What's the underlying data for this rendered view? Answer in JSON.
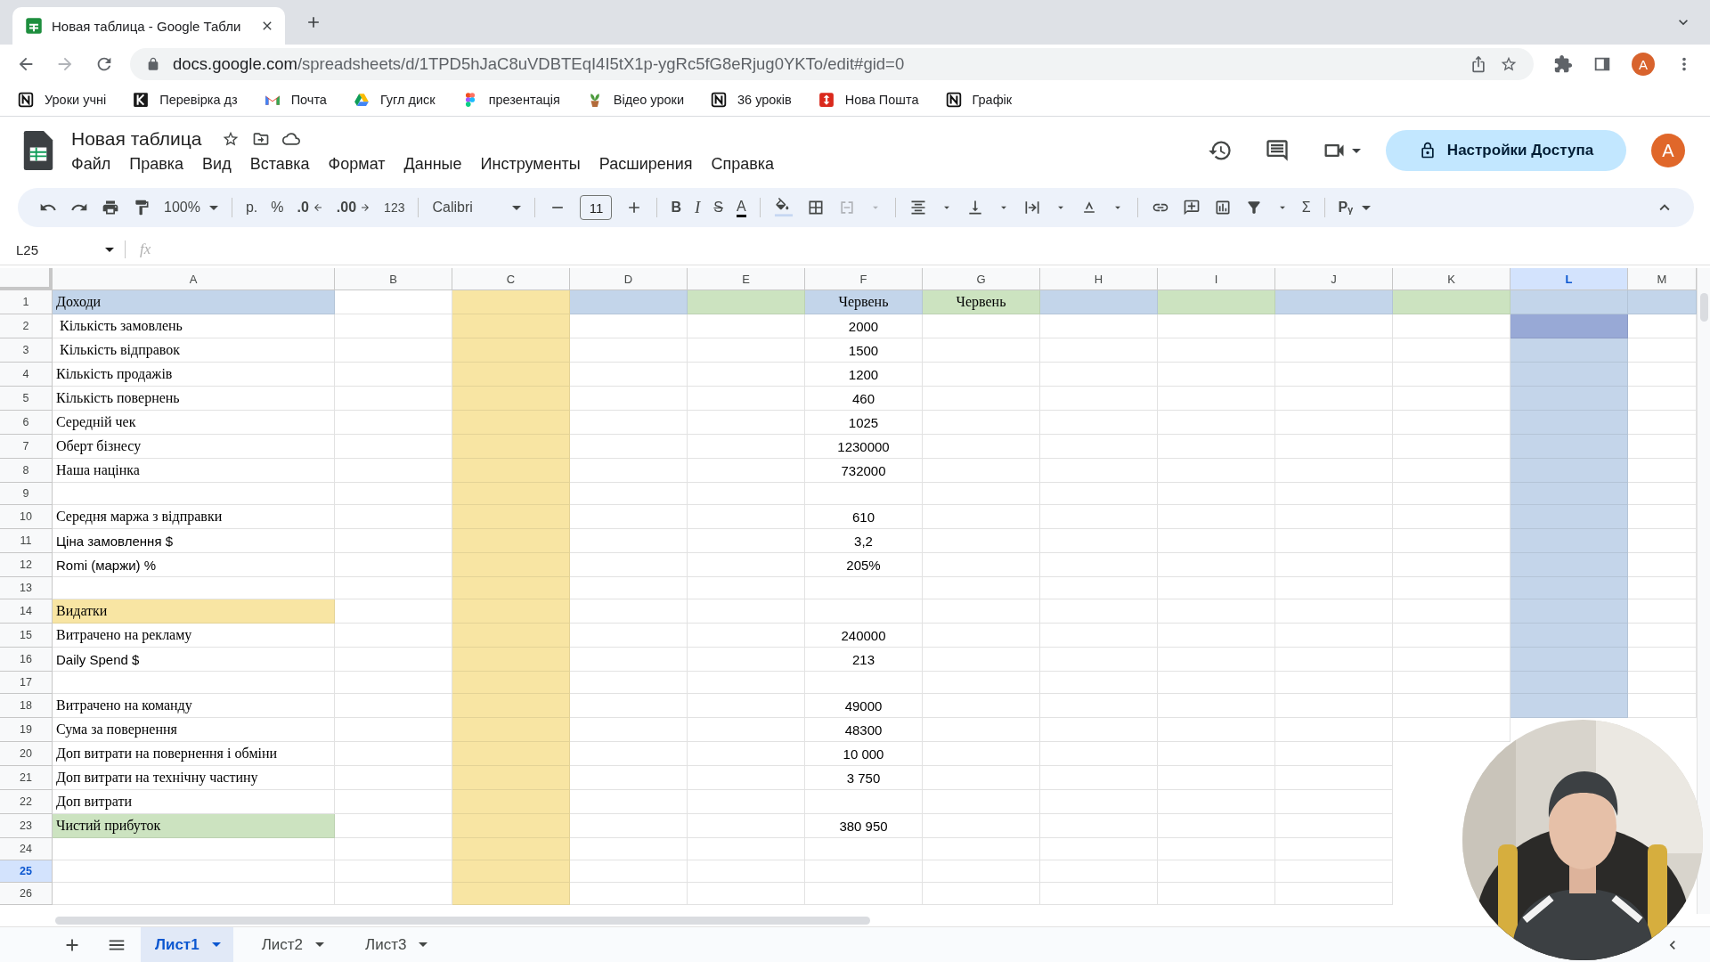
{
  "browser": {
    "tab_title": "Новая таблица - Google Табли",
    "url_host": "docs.google.com",
    "url_path": "/spreadsheets/d/1TPD5hJaC8uVDBTEqI4I5tX1p-ygRc5fG8eRjug0YKTo/edit#gid=0",
    "profile": "A",
    "bookmarks": [
      {
        "label": "Уроки учні",
        "kind": "notion"
      },
      {
        "label": "Перевірка дз",
        "kind": "k"
      },
      {
        "label": "Почта",
        "kind": "gmail"
      },
      {
        "label": "Гугл диск",
        "kind": "drive"
      },
      {
        "label": "презентація",
        "kind": "figma"
      },
      {
        "label": "Відео уроки",
        "kind": "plant"
      },
      {
        "label": "36 уроків",
        "kind": "notion"
      },
      {
        "label": "Нова Пошта",
        "kind": "nova"
      },
      {
        "label": "Графік",
        "kind": "notion"
      }
    ]
  },
  "document": {
    "title": "Новая таблица",
    "menu": [
      "Файл",
      "Правка",
      "Вид",
      "Вставка",
      "Формат",
      "Данные",
      "Инструменты",
      "Расширения",
      "Справка"
    ],
    "share_button": "Настройки Доступа",
    "avatar": "A"
  },
  "toolbar": {
    "zoom": "100%",
    "currency": "р.",
    "percent": "%",
    "decrease_decimals": ".0",
    "increase_decimals": ".00",
    "number_format": "123",
    "font": "Calibri",
    "font_size": "11",
    "bold": "B",
    "italic": "I",
    "strikethrough": "S",
    "text_color": "A",
    "functions": "Σ",
    "input_tools": "Pᵧ"
  },
  "formula_bar": {
    "cell_reference": "L25",
    "fx": "fx"
  },
  "sheet": {
    "columns": [
      {
        "label": "A",
        "selected": false
      },
      {
        "label": "B",
        "selected": false
      },
      {
        "label": "C",
        "selected": false,
        "color": "#f8e5a3"
      },
      {
        "label": "D",
        "selected": false
      },
      {
        "label": "E",
        "selected": false
      },
      {
        "label": "F",
        "selected": false
      },
      {
        "label": "G",
        "selected": false
      },
      {
        "label": "H",
        "selected": false
      },
      {
        "label": "I",
        "selected": false
      },
      {
        "label": "J",
        "selected": false
      },
      {
        "label": "K",
        "selected": false
      },
      {
        "label": "L",
        "selected": true
      },
      {
        "label": "M",
        "selected": false
      }
    ],
    "rows": [
      {
        "number": "1",
        "selected": false,
        "cells": [
          {
            "text": "Доходи",
            "color": "#c3d5ea"
          },
          {},
          {},
          {
            "color": "#c3d5ea"
          },
          {
            "color": "#cce3c0"
          },
          {
            "text": "Червень",
            "color": "#c3d5ea"
          },
          {
            "text": "Червень",
            "color": "#cce3c0"
          },
          {
            "color": "#c3d5ea"
          },
          {
            "color": "#cce3c0"
          },
          {
            "color": "#c3d5ea"
          },
          {
            "color": "#cce3c0"
          },
          {
            "color": "#c3d5ea"
          },
          {
            "color": "#c3d5ea"
          }
        ]
      },
      {
        "number": "2",
        "selected": false,
        "cells": [
          {
            "text": " Кількість замовлень"
          },
          {},
          {},
          {},
          {},
          {
            "text": "2000"
          },
          {},
          {},
          {},
          {},
          {},
          {
            "color": "#98a9d6"
          },
          {}
        ]
      },
      {
        "number": "3",
        "selected": false,
        "cells": [
          {
            "text": " Кількість відправок"
          },
          {},
          {},
          {},
          {},
          {
            "text": "1500"
          },
          {},
          {},
          {},
          {},
          {},
          {},
          {}
        ]
      },
      {
        "number": "4",
        "selected": false,
        "cells": [
          {
            "text": "Кількість продажів"
          },
          {},
          {},
          {},
          {},
          {
            "text": "1200"
          },
          {},
          {},
          {},
          {},
          {},
          {},
          {}
        ]
      },
      {
        "number": "5",
        "selected": false,
        "cells": [
          {
            "text": "Кількість повернень"
          },
          {},
          {},
          {},
          {},
          {
            "text": "460"
          },
          {},
          {},
          {},
          {},
          {},
          {},
          {}
        ]
      },
      {
        "number": "6",
        "selected": false,
        "cells": [
          {
            "text": "Середній чек"
          },
          {},
          {},
          {},
          {},
          {
            "text": "1025"
          },
          {},
          {},
          {},
          {},
          {},
          {},
          {}
        ]
      },
      {
        "number": "7",
        "selected": false,
        "cells": [
          {
            "text": "Оберт бізнесу"
          },
          {},
          {},
          {},
          {},
          {
            "text": "1230000"
          },
          {},
          {},
          {},
          {},
          {},
          {},
          {}
        ]
      },
      {
        "number": "8",
        "selected": false,
        "cells": [
          {
            "text": "Наша націнка"
          },
          {},
          {},
          {},
          {},
          {
            "text": "732000"
          },
          {},
          {},
          {},
          {},
          {},
          {},
          {}
        ]
      },
      {
        "number": "9",
        "selected": false,
        "cells": [
          {},
          {},
          {},
          {},
          {},
          {},
          {},
          {},
          {},
          {},
          {},
          {},
          {}
        ]
      },
      {
        "number": "10",
        "selected": false,
        "cells": [
          {
            "text": "Середня маржа з відправки"
          },
          {},
          {},
          {},
          {},
          {
            "text": "610"
          },
          {},
          {},
          {},
          {},
          {},
          {},
          {}
        ]
      },
      {
        "number": "11",
        "selected": false,
        "cells": [
          {
            "text": "Ціна замовлення $"
          },
          {},
          {},
          {},
          {},
          {
            "text": "3,2"
          },
          {},
          {},
          {},
          {},
          {},
          {},
          {}
        ]
      },
      {
        "number": "12",
        "selected": false,
        "cells": [
          {
            "text": "Romi (маржи) %"
          },
          {},
          {},
          {},
          {},
          {
            "text": "205%"
          },
          {},
          {},
          {},
          {},
          {},
          {},
          {}
        ]
      },
      {
        "number": "13",
        "selected": false,
        "cells": [
          {},
          {},
          {},
          {},
          {},
          {},
          {},
          {},
          {},
          {},
          {},
          {},
          {}
        ]
      },
      {
        "number": "14",
        "selected": false,
        "cells": [
          {
            "text": "Видатки",
            "color": "#f8e5a3"
          },
          {},
          {},
          {},
          {},
          {},
          {},
          {},
          {},
          {},
          {},
          {},
          {}
        ]
      },
      {
        "number": "15",
        "selected": false,
        "cells": [
          {
            "text": "Витрачено на рекламу"
          },
          {},
          {},
          {},
          {},
          {
            "text": "240000"
          },
          {},
          {},
          {},
          {},
          {},
          {},
          {}
        ]
      },
      {
        "number": "16",
        "selected": false,
        "cells": [
          {
            "text": "Daily Spend $"
          },
          {},
          {},
          {},
          {},
          {
            "text": "213"
          },
          {},
          {},
          {},
          {},
          {},
          {},
          {}
        ]
      },
      {
        "number": "17",
        "selected": false,
        "cells": [
          {},
          {},
          {},
          {},
          {},
          {},
          {},
          {},
          {},
          {},
          {},
          {},
          {}
        ]
      },
      {
        "number": "18",
        "selected": false,
        "cells": [
          {
            "text": "Витрачено на команду"
          },
          {},
          {},
          {},
          {},
          {
            "text": "49000"
          },
          {},
          {},
          {},
          {},
          {},
          {},
          {}
        ]
      },
      {
        "number": "19",
        "selected": false,
        "cells": [
          {
            "text": "Сума за повернення"
          },
          {},
          {},
          {},
          {},
          {
            "text": "48300"
          },
          {},
          {},
          {},
          {},
          {},
          {},
          {}
        ]
      },
      {
        "number": "20",
        "selected": false,
        "cells": [
          {
            "text": "Доп витрати на повернення і обміни"
          },
          {},
          {},
          {},
          {},
          {
            "text": "10 000"
          },
          {},
          {},
          {},
          {},
          {},
          {},
          {}
        ]
      },
      {
        "number": "21",
        "selected": false,
        "cells": [
          {
            "text": "Доп витрати на технічну частину"
          },
          {},
          {},
          {},
          {},
          {
            "text": "3 750"
          },
          {},
          {},
          {},
          {},
          {},
          {},
          {}
        ]
      },
      {
        "number": "22",
        "selected": false,
        "cells": [
          {
            "text": "Доп витрати"
          },
          {},
          {},
          {},
          {},
          {},
          {},
          {},
          {},
          {},
          {},
          {},
          {}
        ]
      },
      {
        "number": "23",
        "selected": false,
        "cells": [
          {
            "text": "Чистий прибуток",
            "color": "#cce3c0"
          },
          {},
          {},
          {},
          {},
          {
            "text": "380 950"
          },
          {},
          {},
          {},
          {},
          {},
          {},
          {}
        ]
      },
      {
        "number": "24",
        "selected": false,
        "cells": [
          {},
          {},
          {},
          {},
          {},
          {},
          {},
          {},
          {},
          {},
          {},
          {},
          {}
        ]
      },
      {
        "number": "25",
        "selected": true,
        "cells": [
          {},
          {},
          {},
          {},
          {},
          {},
          {},
          {},
          {},
          {},
          {},
          {},
          {}
        ]
      },
      {
        "number": "26",
        "selected": false,
        "cells": [
          {},
          {},
          {},
          {},
          {},
          {},
          {},
          {},
          {},
          {},
          {},
          {},
          {}
        ]
      }
    ]
  },
  "sheet_tabs": [
    {
      "label": "Лист1",
      "selected": true
    },
    {
      "label": "Лист2",
      "selected": false
    },
    {
      "label": "Лист3",
      "selected": false
    }
  ]
}
